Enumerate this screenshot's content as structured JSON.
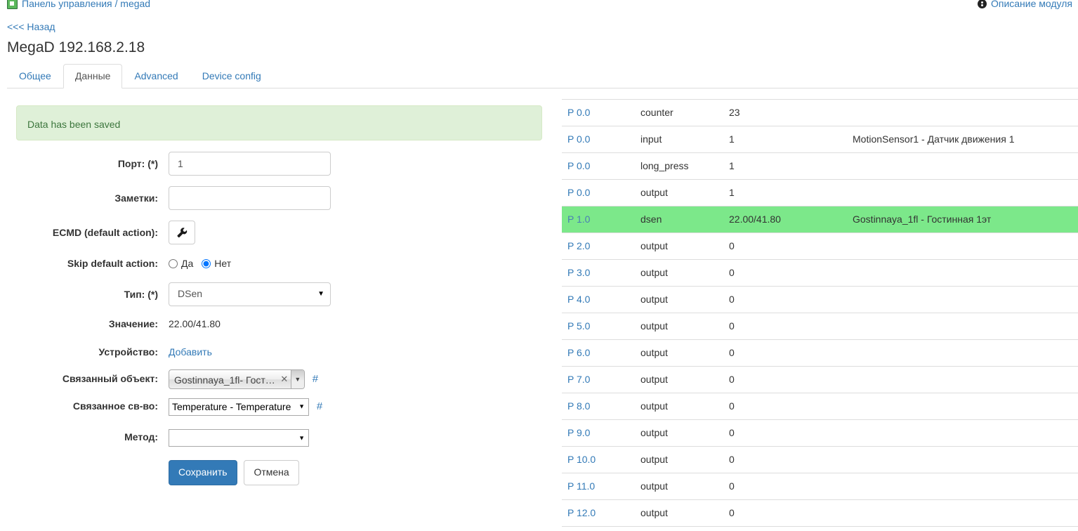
{
  "breadcrumb": {
    "icon": "app-icon",
    "text": "Панель управления / megad",
    "right_icon": "info-circle-icon",
    "right_text": "Описание модуля"
  },
  "back_link": "<<< Назад",
  "page_title": "MegaD 192.168.2.18",
  "tabs": [
    {
      "label": "Общее",
      "active": false
    },
    {
      "label": "Данные",
      "active": true
    },
    {
      "label": "Advanced",
      "active": false
    },
    {
      "label": "Device config",
      "active": false
    }
  ],
  "alert": {
    "message": "Data has been saved",
    "bg": "#dff0d8",
    "border": "#d6e9c6",
    "color": "#3c763d"
  },
  "form": {
    "port": {
      "label": "Порт: (*)",
      "value": "1",
      "placeholder": ""
    },
    "notes": {
      "label": "Заметки:",
      "value": "",
      "placeholder": ""
    },
    "ecmd": {
      "label": "ECMD (default action):",
      "button_icon": "wrench-icon"
    },
    "skip_default_action": {
      "label": "Skip default action:",
      "options": [
        "Да",
        "Нет"
      ],
      "selected": "Нет"
    },
    "type": {
      "label": "Тип: (*)",
      "value": "DSen"
    },
    "value": {
      "label": "Значение:",
      "value": "22.00/41.80"
    },
    "device": {
      "label": "Устройство:",
      "link": "Добавить"
    },
    "linked_object": {
      "label": "Связанный объект:",
      "value": "Gostinnaya_1fl- Гост…",
      "clear_icon": "clear-x-icon",
      "dropdown_icon": "chevron-down-icon",
      "hash": "#"
    },
    "linked_property": {
      "label": "Связанное св-во:",
      "value": "Temperature - Temperature",
      "hash": "#"
    },
    "method": {
      "label": "Метод:",
      "value": ""
    },
    "save_label": "Сохранить",
    "cancel_label": "Отмена",
    "save_color": "#337ab7"
  },
  "table": {
    "highlight_color": "#7ce88a",
    "rows": [
      {
        "port": "P 0.0",
        "type": "counter",
        "value": "23",
        "name": "",
        "highlight": false
      },
      {
        "port": "P 0.0",
        "type": "input",
        "value": "1",
        "name": "MotionSensor1 - Датчик движения 1",
        "highlight": false
      },
      {
        "port": "P 0.0",
        "type": "long_press",
        "value": "1",
        "name": "",
        "highlight": false
      },
      {
        "port": "P 0.0",
        "type": "output",
        "value": "1",
        "name": "",
        "highlight": false
      },
      {
        "port": "P 1.0",
        "type": "dsen",
        "value": "22.00/41.80",
        "name": "Gostinnaya_1fl - Гостинная 1эт",
        "highlight": true
      },
      {
        "port": "P 2.0",
        "type": "output",
        "value": "0",
        "name": "",
        "highlight": false
      },
      {
        "port": "P 3.0",
        "type": "output",
        "value": "0",
        "name": "",
        "highlight": false
      },
      {
        "port": "P 4.0",
        "type": "output",
        "value": "0",
        "name": "",
        "highlight": false
      },
      {
        "port": "P 5.0",
        "type": "output",
        "value": "0",
        "name": "",
        "highlight": false
      },
      {
        "port": "P 6.0",
        "type": "output",
        "value": "0",
        "name": "",
        "highlight": false
      },
      {
        "port": "P 7.0",
        "type": "output",
        "value": "0",
        "name": "",
        "highlight": false
      },
      {
        "port": "P 8.0",
        "type": "output",
        "value": "0",
        "name": "",
        "highlight": false
      },
      {
        "port": "P 9.0",
        "type": "output",
        "value": "0",
        "name": "",
        "highlight": false
      },
      {
        "port": "P 10.0",
        "type": "output",
        "value": "0",
        "name": "",
        "highlight": false
      },
      {
        "port": "P 11.0",
        "type": "output",
        "value": "0",
        "name": "",
        "highlight": false
      },
      {
        "port": "P 12.0",
        "type": "output",
        "value": "0",
        "name": "",
        "highlight": false
      }
    ]
  }
}
